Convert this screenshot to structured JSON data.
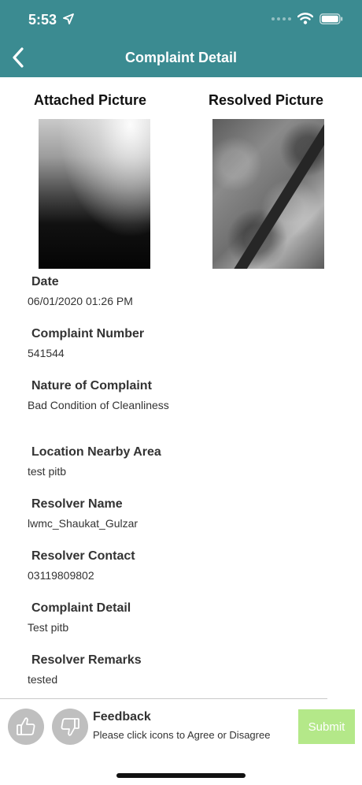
{
  "status_bar": {
    "time": "5:53"
  },
  "header": {
    "title": "Complaint Detail"
  },
  "pictures": {
    "attached_title": "Attached Picture",
    "resolved_title": "Resolved Picture"
  },
  "details": [
    {
      "label": "Date",
      "value": "06/01/2020 01:26 PM"
    },
    {
      "label": "Complaint Number",
      "value": "541544"
    },
    {
      "label": "Nature of Complaint",
      "value": "Bad Condition of Cleanliness"
    },
    {
      "label": "Location Nearby Area",
      "value": "test pitb"
    },
    {
      "label": "Resolver Name",
      "value": "lwmc_Shaukat_Gulzar"
    },
    {
      "label": "Resolver Contact",
      "value": "03119809802"
    },
    {
      "label": "Complaint Detail",
      "value": "Test pitb"
    },
    {
      "label": "Resolver Remarks",
      "value": "tested"
    }
  ],
  "feedback": {
    "title": "Feedback",
    "subtitle": "Please click icons to Agree or Disagree",
    "submit_label": "Submit"
  },
  "colors": {
    "header_bg": "#3b8b91",
    "submit_bg": "#b4e889",
    "icon_circle": "#bfbfbf"
  },
  "icons": {
    "back": "chevron-left-icon",
    "location": "location-arrow-icon",
    "signal": "cellular-signal-icon",
    "wifi": "wifi-icon",
    "battery": "battery-icon",
    "agree": "thumbs-up-icon",
    "disagree": "thumbs-down-icon"
  }
}
